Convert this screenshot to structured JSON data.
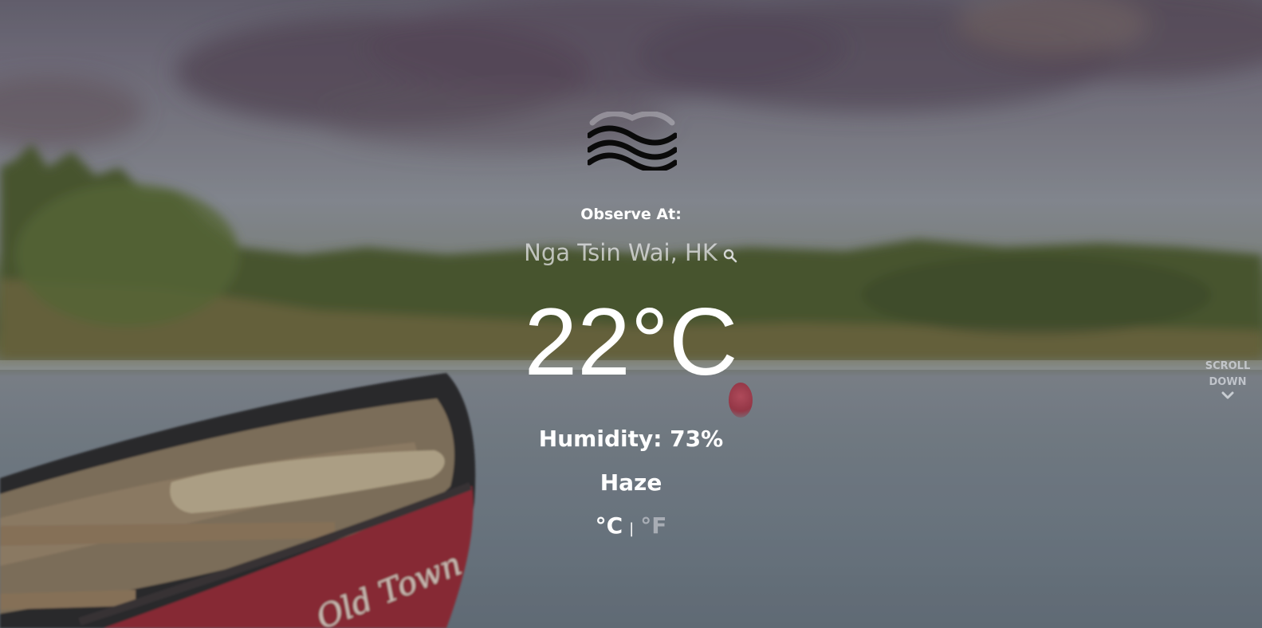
{
  "observe_label": "Observe At:",
  "location": "Nga Tsin Wai, HK",
  "temperature": "22°C",
  "humidity": "Humidity: 73%",
  "condition": "Haze",
  "units": {
    "celsius": "°C",
    "separator": "|",
    "fahrenheit": "°F",
    "selected": "celsius"
  },
  "scroll_hint": {
    "line1": "SCROLL",
    "line2": "DOWN"
  },
  "icons": {
    "weather": "haze-icon",
    "search": "search-icon",
    "scroll": "chevron-down-icon"
  },
  "colors": {
    "text_primary": "#ffffff",
    "text_muted": "#dcdce1",
    "canoe_hull": "#9b2a36"
  }
}
